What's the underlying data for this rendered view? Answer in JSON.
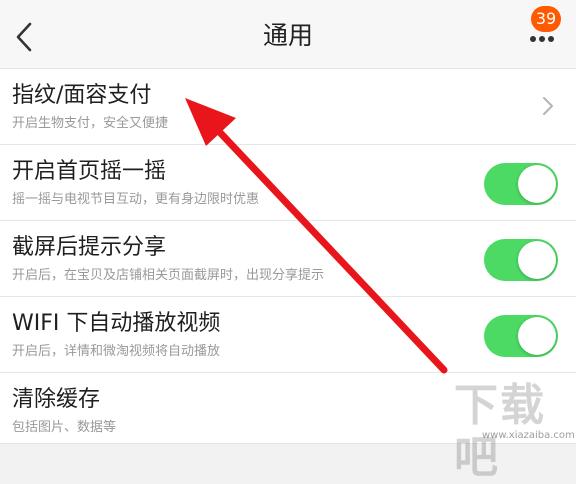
{
  "nav": {
    "title": "通用",
    "badge_count": "39"
  },
  "settings": [
    {
      "label": "指纹/面容支付",
      "sub": "开启生物支付，安全又便捷",
      "control": "chevron"
    },
    {
      "label": "开启首页摇一摇",
      "sub": "摇一摇与电视节目互动，更有身边限时优惠",
      "control": "toggle",
      "on": true
    },
    {
      "label": "截屏后提示分享",
      "sub": "开启后，在宝贝及店铺相关页面截屏时，出现分享提示",
      "control": "toggle",
      "on": true
    },
    {
      "label": "WIFI 下自动播放视频",
      "sub": "开启后，详情和微淘视频将自动播放",
      "control": "toggle",
      "on": true
    },
    {
      "label": "清除缓存",
      "sub": "包括图片、数据等",
      "control": "none"
    }
  ],
  "watermark": {
    "logo_text": "下载吧",
    "url": "www.xiazaiba.com"
  },
  "colors": {
    "toggle_on": "#4cd964",
    "badge": "#ff5a00",
    "annotation_arrow": "#e8161b"
  }
}
